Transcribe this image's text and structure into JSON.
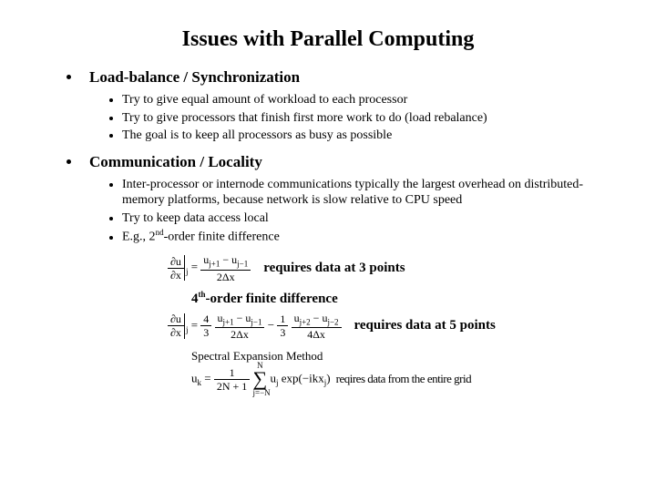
{
  "title": "Issues with Parallel Computing",
  "top_items": [
    {
      "heading": "Load-balance / Synchronization",
      "subs": [
        "Try to give equal amount of workload to each processor",
        "Try to give processors that finish first more work to do (load rebalance)",
        "The goal is to keep all processors as busy as possible"
      ]
    },
    {
      "heading": "Communication / Locality",
      "subs": [
        "Inter-processor or internode communications typically the largest overhead on distributed-memory platforms, because network is slow relative to CPU speed",
        "Try to keep data access local",
        "E.g., 2nd-order finite difference"
      ]
    }
  ],
  "formula1_req": "requires data at 3 points",
  "fourth_order_label": "4th-order finite difference",
  "formula2_req": "requires data at 5 points",
  "spectral_title": "Spectral Expansion Method",
  "spectral_req": "reqires data from the entire grid",
  "formula_symbols": {
    "du_dx": "∂u",
    "dx": "∂x",
    "uj": "u",
    "jp1": "j+1",
    "jm1": "j−1",
    "jp2": "j+2",
    "jm2": "j−2",
    "two_dx": "2Δx",
    "four_dx": "4Δx",
    "four_thirds_num": "4",
    "four_thirds_den": "3",
    "one_third_num": "1",
    "one_third_den": "3",
    "uk": "u",
    "k": "k",
    "sum_top": "N",
    "sum_bot": "j=−N",
    "two_n_plus_1": "2N + 1",
    "exp_body": "exp(−ikx",
    "exp_close": ")"
  }
}
